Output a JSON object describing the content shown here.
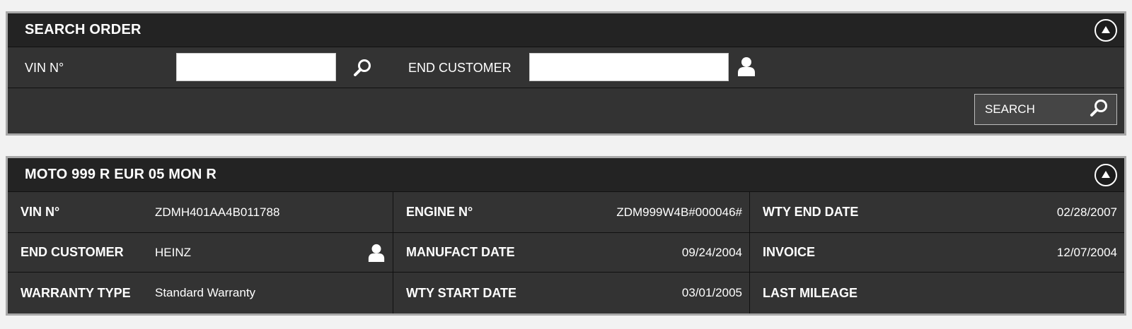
{
  "search_panel": {
    "title": "SEARCH ORDER",
    "vin_label": "VIN N°",
    "vin_value": "",
    "end_customer_label": "END CUSTOMER",
    "end_customer_value": "",
    "search_button_label": "SEARCH",
    "icons": {
      "vin_lookup": "magnifier-icon",
      "customer_lookup": "person-icon",
      "search_button": "magnifier-icon",
      "collapse": "collapse-up-icon"
    }
  },
  "detail_panel": {
    "title": "MOTO 999 R EUR 05 MON R",
    "fields": {
      "vin": {
        "label": "VIN N°",
        "value": "ZDMH401AA4B011788"
      },
      "engine": {
        "label": "ENGINE N°",
        "value": "ZDM999W4B#000046#"
      },
      "wty_end_date": {
        "label": "WTY END DATE",
        "value": "02/28/2007"
      },
      "end_customer": {
        "label": "END CUSTOMER",
        "value": "HEINZ"
      },
      "manufact_date": {
        "label": "MANUFACT DATE",
        "value": "09/24/2004"
      },
      "invoice": {
        "label": "INVOICE",
        "value": "12/07/2004"
      },
      "warranty_type": {
        "label": "WARRANTY TYPE",
        "value": "Standard Warranty"
      },
      "wty_start_date": {
        "label": "WTY START DATE",
        "value": "03/01/2005"
      },
      "last_mileage": {
        "label": "LAST MILEAGE",
        "value": ""
      }
    }
  },
  "colors": {
    "panel_bg": "#333333",
    "header_bg": "#232323",
    "border": "#a9a9a9",
    "page_bg": "#f2f2f2",
    "text": "#ffffff"
  }
}
